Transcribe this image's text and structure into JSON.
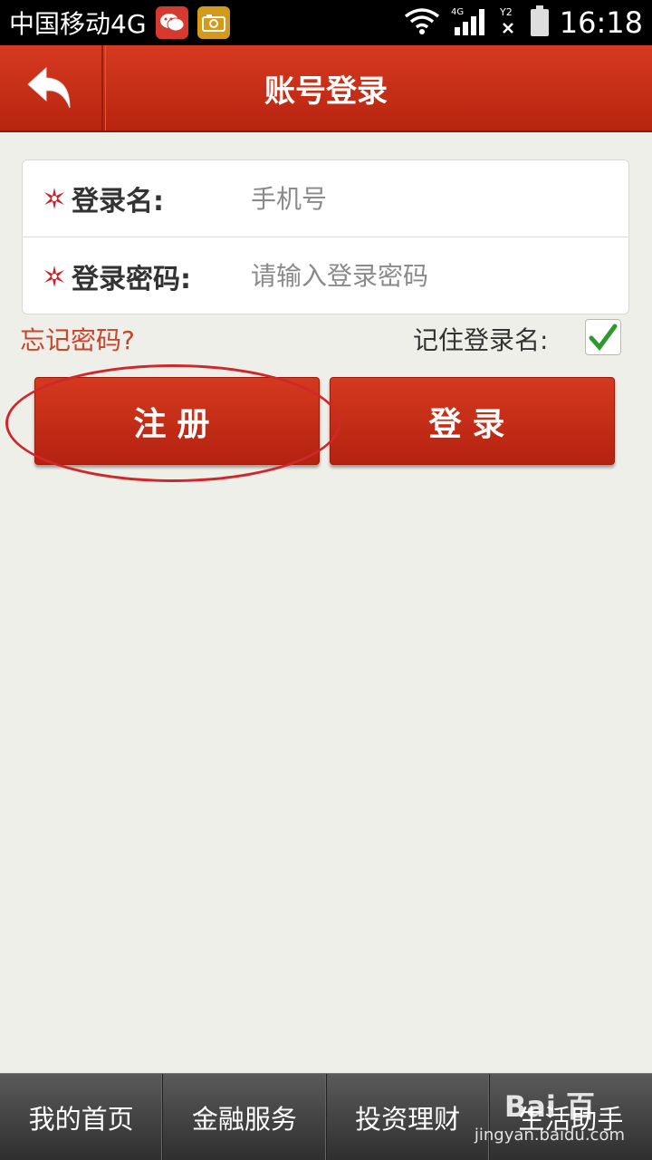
{
  "status_bar": {
    "carrier": "中国移动4G",
    "time": "16:18",
    "network": "4G",
    "sim": "Y2"
  },
  "header": {
    "title": "账号登录",
    "back_icon": "back-arrow-icon"
  },
  "form": {
    "username_label": "登录名:",
    "username_placeholder": "手机号",
    "password_label": "登录密码:",
    "password_placeholder": "请输入登录密码"
  },
  "options": {
    "forgot_password": "忘记密码?",
    "remember_label": "记住登录名:",
    "remember_checked": true
  },
  "buttons": {
    "register": "注册",
    "login": "登录"
  },
  "bottom_nav": {
    "items": [
      "我的首页",
      "金融服务",
      "投资理财",
      "生活助手"
    ]
  },
  "watermark": {
    "logo": "Bai 百",
    "url": "jingyan.baidu.com"
  },
  "colors": {
    "brand_red": "#c62d16",
    "accent_link": "#c8452a",
    "check_green": "#2e9a2e"
  }
}
